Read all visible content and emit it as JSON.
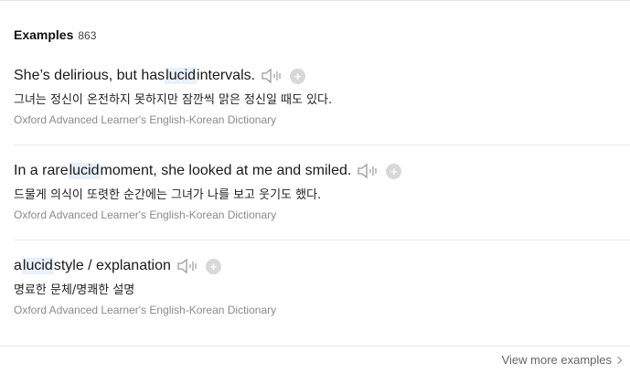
{
  "section": {
    "title": "Examples",
    "count": "863"
  },
  "examples": [
    {
      "before": "She’s delirious, but has ",
      "keyword": "lucid",
      "after": " intervals.",
      "translation": "그녀는 정신이 온전하지 못하지만 잠깐씩 맑은 정신일 때도 있다.",
      "source": "Oxford Advanced Learner's English-Korean Dictionary"
    },
    {
      "before": "In a rare ",
      "keyword": "lucid",
      "after": " moment, she looked at me and smiled.",
      "translation": "드물게 의식이 또렷한 순간에는 그녀가 나를 보고 웃기도 했다.",
      "source": "Oxford Advanced Learner's English-Korean Dictionary"
    },
    {
      "before": "a ",
      "keyword": "lucid",
      "after": " style / explanation",
      "translation": "명료한 문체/명쾌한 설명",
      "source": "Oxford Advanced Learner's English-Korean Dictionary"
    }
  ],
  "icons": {
    "speaker": "speaker-icon",
    "add": "add-icon",
    "chevron": "chevron-right-icon"
  },
  "plus_glyph": "+",
  "footer": {
    "view_more": "View more examples"
  },
  "colors": {
    "highlight": "#e8f0fb",
    "icon_gray": "#d8d8d8",
    "source_gray": "#8a8a8a"
  }
}
